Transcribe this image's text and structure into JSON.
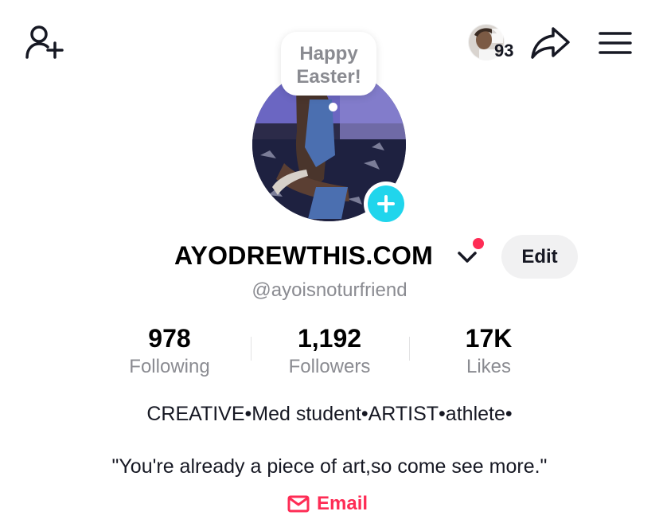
{
  "header": {
    "add_friend_icon": "person-add-icon",
    "friends_avatar_count": "93",
    "share_icon": "share-arrow-icon",
    "menu_icon": "hamburger-menu-icon"
  },
  "note": {
    "text": "Happy\nEaster!"
  },
  "profile": {
    "display_name": "AYODREWTHIS.COM",
    "edit_label": "Edit",
    "username": "@ayoisnoturfriend",
    "notification_dot_color": "#fe2c55",
    "accent_color": "#20d5ec"
  },
  "stats": [
    {
      "value": "978",
      "label": "Following"
    },
    {
      "value": "1,192",
      "label": "Followers"
    },
    {
      "value": "17K",
      "label": "Likes"
    }
  ],
  "bio": {
    "line1": "CREATIVE•Med student•ARTIST•athlete•",
    "line2": "\"You're already a piece of art,so come see more.\""
  },
  "contact": {
    "email_label": "Email",
    "email_icon": "envelope-icon",
    "color": "#fe2c55"
  }
}
